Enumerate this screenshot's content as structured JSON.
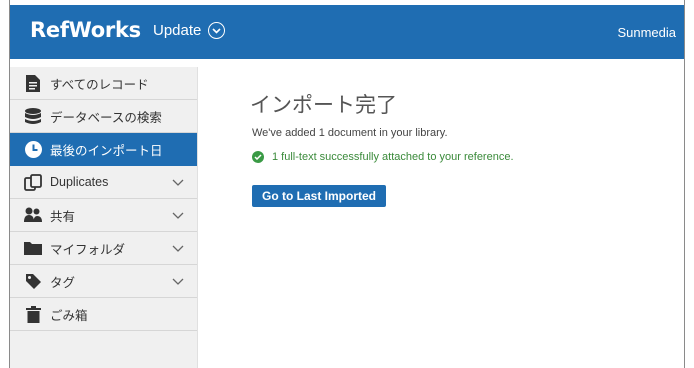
{
  "header": {
    "brand": "RefWorks",
    "update_label": "Update",
    "user_name": "Sunmedia",
    "bar_color": "#1f6db2"
  },
  "sidebar": {
    "items": [
      {
        "label": "すべてのレコード",
        "icon": "document-icon",
        "active": false,
        "expandable": false
      },
      {
        "label": "データベースの検索",
        "icon": "database-icon",
        "active": false,
        "expandable": false
      },
      {
        "label": "最後のインポート日",
        "icon": "clock-icon",
        "active": true,
        "expandable": false
      },
      {
        "label": "Duplicates",
        "icon": "duplicates-icon",
        "active": false,
        "expandable": true
      },
      {
        "label": "共有",
        "icon": "users-icon",
        "active": false,
        "expandable": true
      },
      {
        "label": "マイフォルダ",
        "icon": "folder-icon",
        "active": false,
        "expandable": true
      },
      {
        "label": "タグ",
        "icon": "tag-icon",
        "active": false,
        "expandable": true
      },
      {
        "label": "ごみ箱",
        "icon": "trash-icon",
        "active": false,
        "expandable": false
      }
    ]
  },
  "main": {
    "title": "インポート完了",
    "added_message": "We've added 1 document in your library.",
    "attached_message": "1 full-text successfully attached to your reference.",
    "button_label": "Go to Last Imported"
  }
}
